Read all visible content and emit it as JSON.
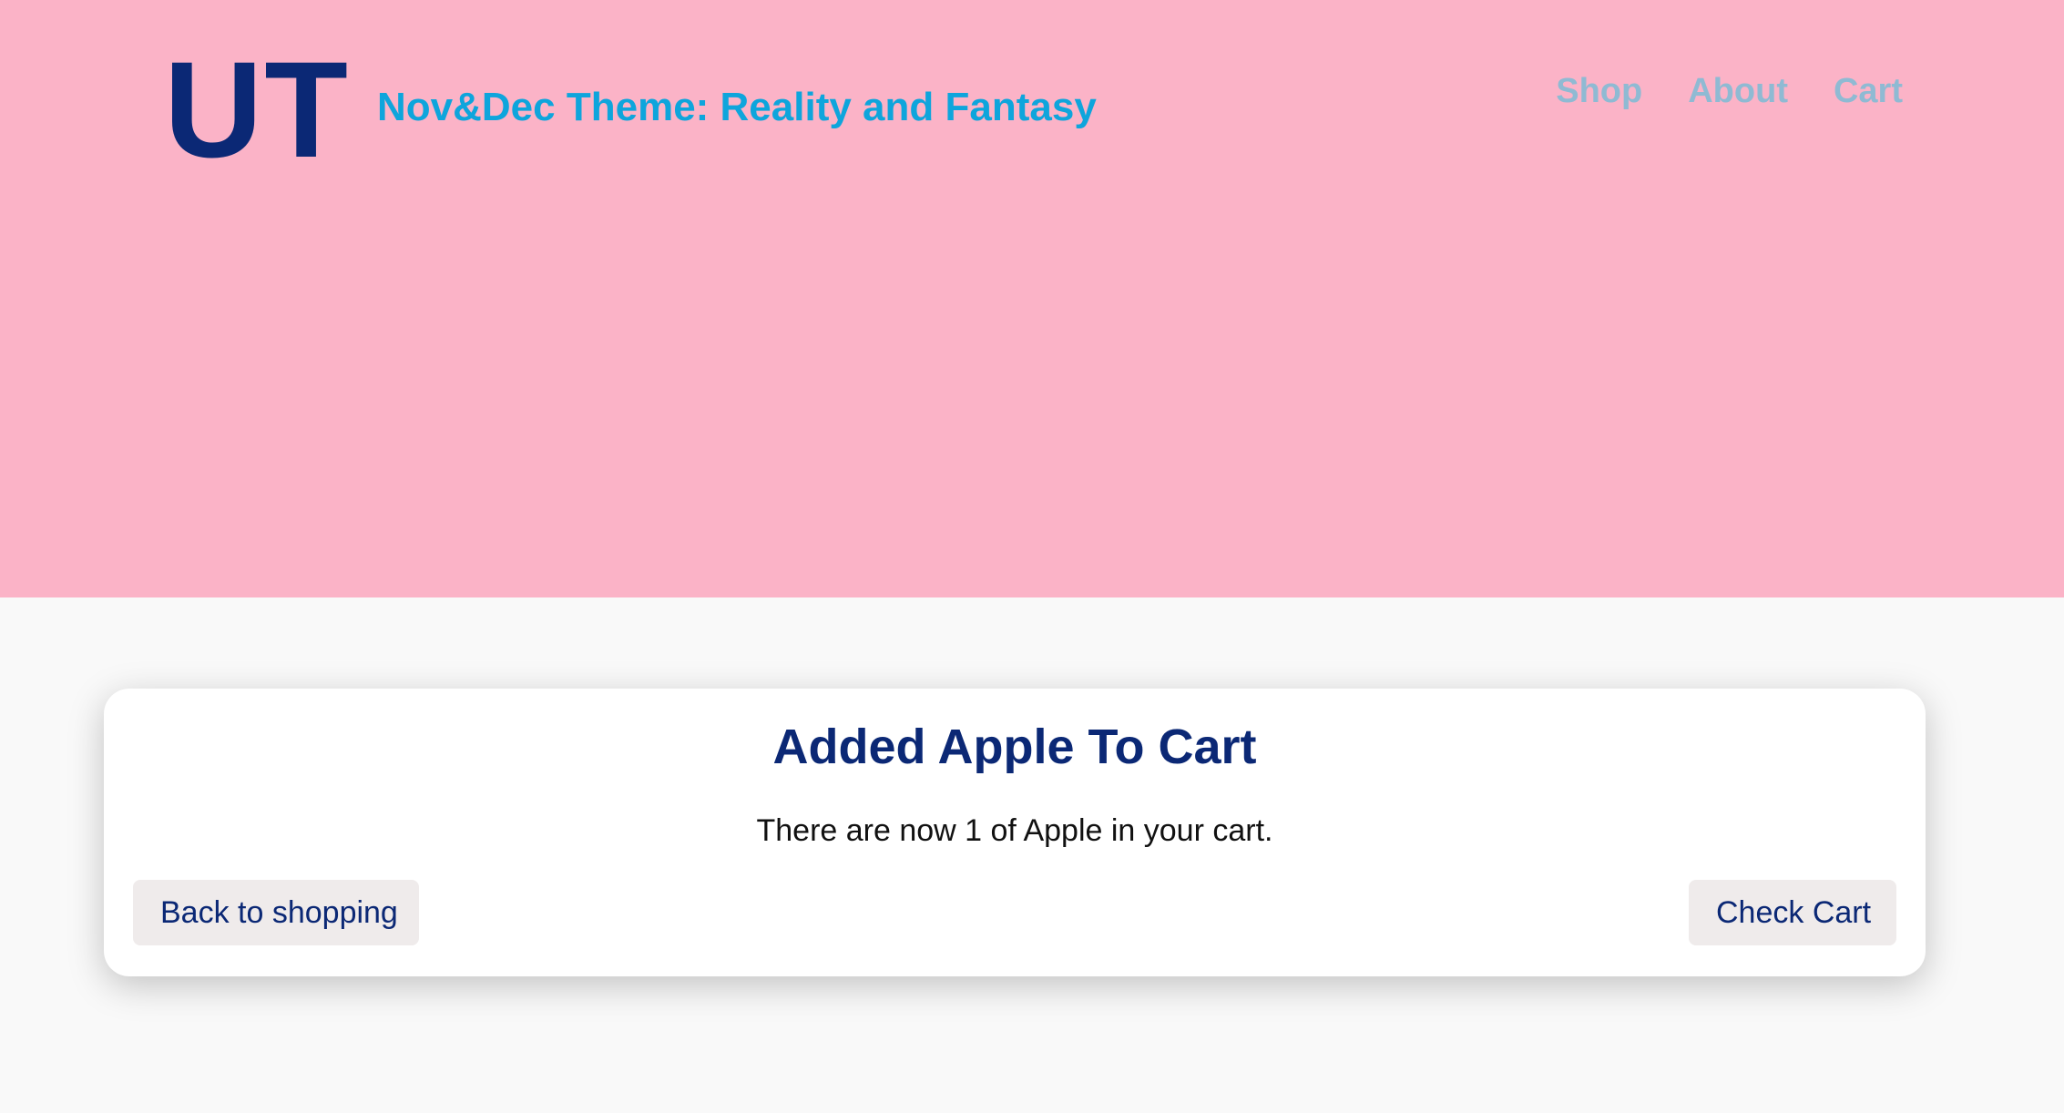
{
  "header": {
    "logo": "UT",
    "tagline": "Nov&Dec Theme: Reality and Fantasy",
    "nav": [
      {
        "label": "Shop"
      },
      {
        "label": "About"
      },
      {
        "label": "Cart"
      }
    ]
  },
  "dialog": {
    "title": "Added Apple To Cart",
    "message": "There are now 1 of Apple in your cart.",
    "back_label": "Back to shopping",
    "check_cart_label": "Check Cart"
  },
  "colors": {
    "hero_background": "#fbb3c7",
    "brand_navy": "#0b2875",
    "tagline_blue": "#0ea5dc",
    "nav_link": "#8fbad3",
    "button_background": "#efebeb",
    "page_background": "#f9f9f9"
  }
}
